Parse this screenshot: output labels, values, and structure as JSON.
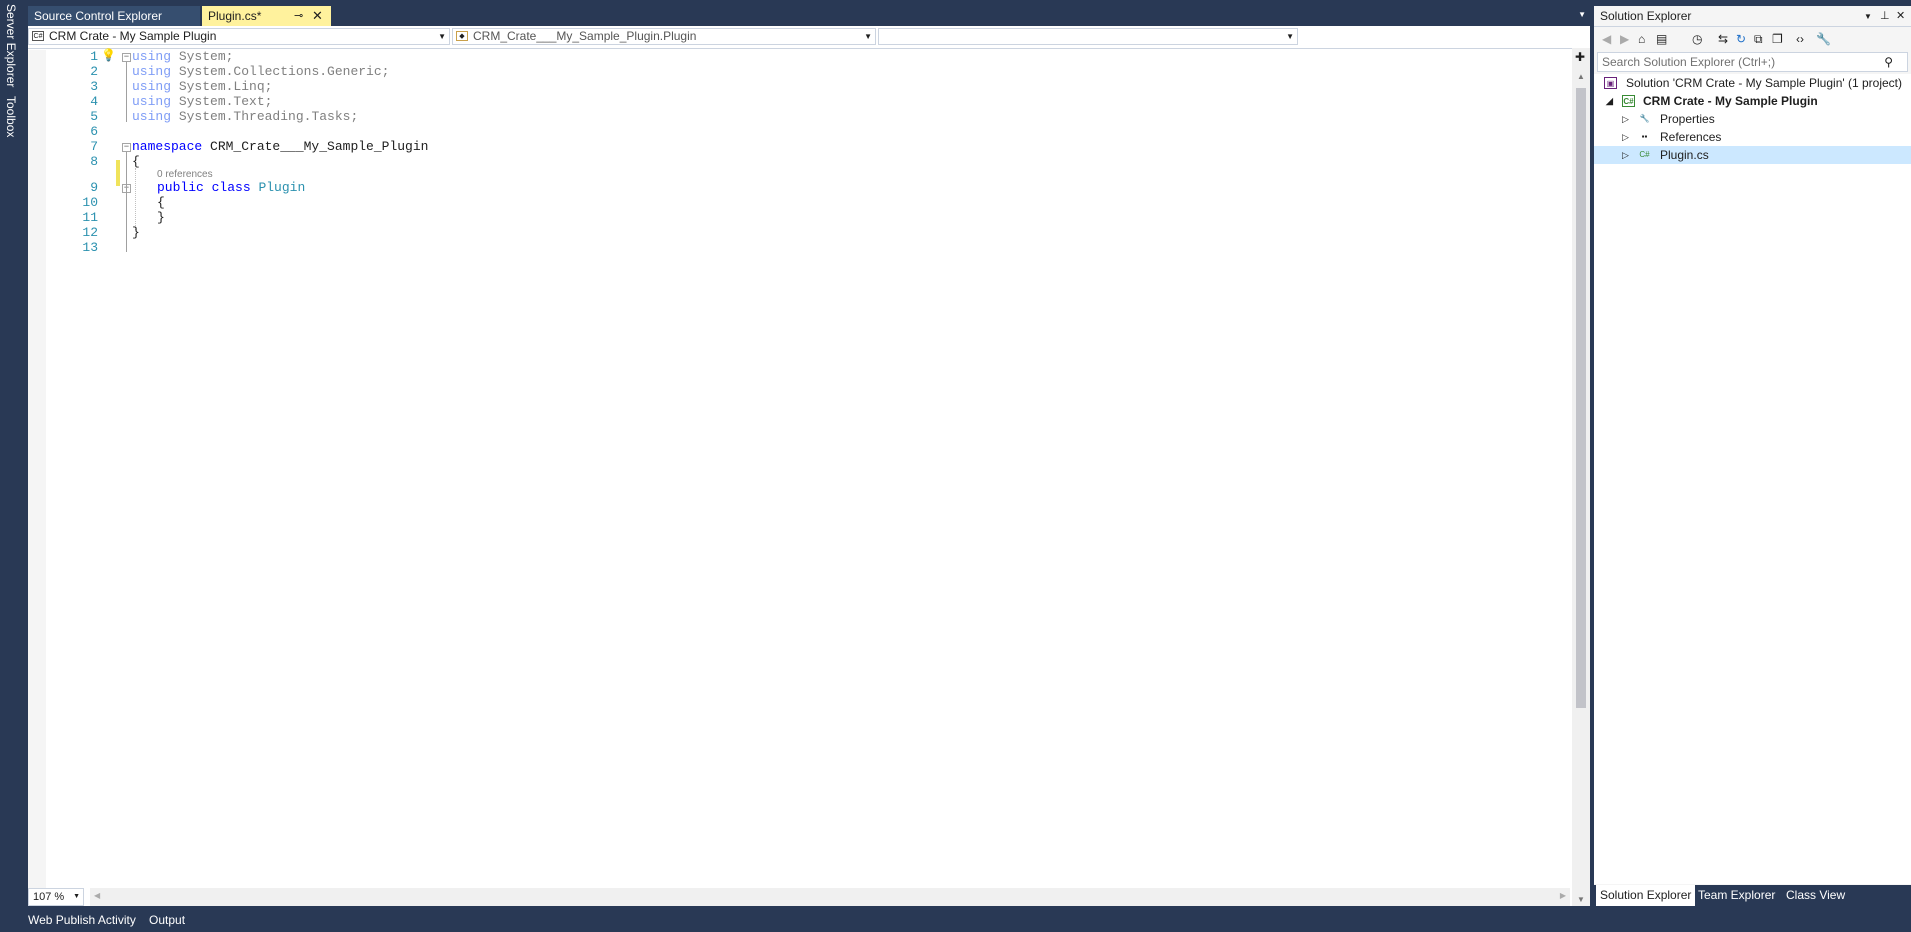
{
  "left_strip": {
    "server_explorer": "Server Explorer",
    "toolbox": "Toolbox"
  },
  "doc_tabs": [
    {
      "label": "Source Control Explorer"
    },
    {
      "label": "Plugin.cs*"
    }
  ],
  "nav": {
    "project": "CRM Crate - My Sample Plugin",
    "type": "CRM_Crate___My_Sample_Plugin.Plugin",
    "member": ""
  },
  "code": {
    "lines": [
      "1",
      "2",
      "3",
      "4",
      "5",
      "6",
      "7",
      "8",
      "9",
      "10",
      "11",
      "12",
      "13"
    ],
    "l1_kw": "using",
    "l1_rest": " System;",
    "l2_kw": "using",
    "l2_rest": " System.Collections.Generic;",
    "l3_kw": "using",
    "l3_rest": " System.Linq;",
    "l4_kw": "using",
    "l4_rest": " System.Text;",
    "l5_kw": "using",
    "l5_rest": " System.Threading.Tasks;",
    "l7_kw": "namespace",
    "l7_rest": " CRM_Crate___My_Sample_Plugin",
    "l8": "{",
    "codelens": "0 references",
    "l9_kw1": "public",
    "l9_kw2": "class",
    "l9_type": "Plugin",
    "l10": "{",
    "l11": "}",
    "l12": "}"
  },
  "zoom": "107 %",
  "bottom_tabs": [
    {
      "label": "Web Publish Activity"
    },
    {
      "label": "Output"
    }
  ],
  "solution_explorer": {
    "title": "Solution Explorer",
    "search_placeholder": "Search Solution Explorer (Ctrl+;)",
    "solution_label": "Solution 'CRM Crate - My Sample Plugin' (1 project)",
    "project_label": "CRM Crate - My Sample Plugin",
    "items": [
      {
        "label": "Properties"
      },
      {
        "label": "References"
      },
      {
        "label": "Plugin.cs"
      }
    ],
    "bottom_tabs": [
      {
        "label": "Solution Explorer"
      },
      {
        "label": "Team Explorer"
      },
      {
        "label": "Class View"
      }
    ]
  },
  "colors": {
    "chrome": "#293955",
    "tab_active": "#fff29d",
    "keyword": "#0000ff",
    "type": "#2b91af"
  }
}
